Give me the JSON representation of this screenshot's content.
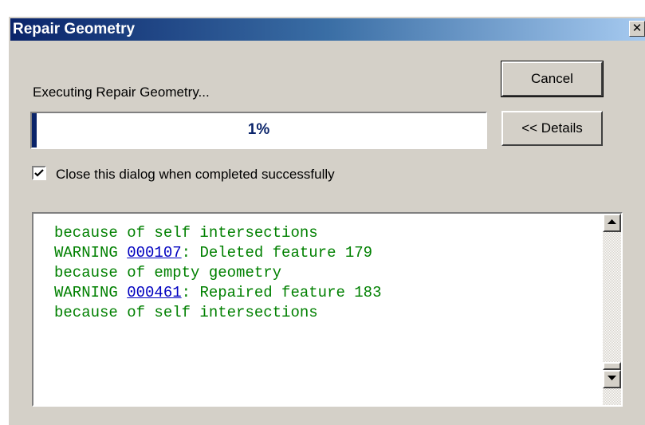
{
  "window": {
    "title": "Repair Geometry",
    "close_icon": "close-icon"
  },
  "status_text": "Executing Repair Geometry...",
  "buttons": {
    "cancel_label": "Cancel",
    "details_label": "<< Details"
  },
  "progress": {
    "percent_text": "1%",
    "value": 0.01
  },
  "checkbox": {
    "label": "Close this dialog when completed successfully",
    "checked": true
  },
  "log": {
    "lines": [
      {
        "text": "because of self intersections"
      },
      {
        "prefix": "WARNING ",
        "code": "000107",
        "suffix": ": Deleted feature 179"
      },
      {
        "text": "because of empty geometry"
      },
      {
        "prefix": "WARNING ",
        "code": "000461",
        "suffix": ": Repaired feature 183"
      },
      {
        "text": "because of self intersections"
      }
    ]
  },
  "colors": {
    "title_bar": "#0a246a",
    "log_text": "#008000",
    "link": "#0000c0",
    "face": "#d4d0c8"
  }
}
